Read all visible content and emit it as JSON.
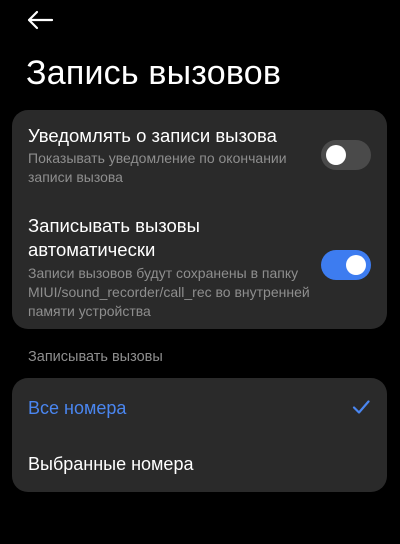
{
  "header": {
    "back_icon": "arrow-left-icon",
    "title": "Запись вызовов"
  },
  "settings": {
    "notify": {
      "title": "Уведомлять о записи вызова",
      "description": "Показывать уведомление по окончании записи вызова",
      "enabled": false
    },
    "auto_record": {
      "title": "Записывать вызовы автоматически",
      "description": "Записи вызовов будут сохранены в папку MIUI/sound_recorder/call_rec во внутренней памяти устройства",
      "enabled": true
    }
  },
  "record_section": {
    "header": "Записывать вызовы",
    "options": [
      {
        "label": "Все номера",
        "selected": true,
        "icon": "checkmark-icon"
      },
      {
        "label": "Выбранные номера",
        "selected": false
      }
    ]
  },
  "colors": {
    "background": "#000000",
    "card": "#2a2a2a",
    "accent": "#3d7cf0",
    "secondary_text": "#8e8e8e",
    "toggle_off": "#4a4a4a"
  }
}
